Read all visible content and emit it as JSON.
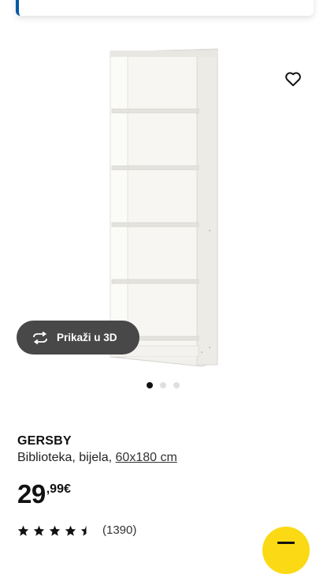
{
  "product": {
    "name": "GERSBY",
    "description_prefix": "Biblioteka, bijela, ",
    "size": "60x180 cm",
    "price_integer": "29",
    "price_decimal": ",99€",
    "rating_value": 4.5,
    "rating_max": 5,
    "review_count": "(1390)"
  },
  "viewer": {
    "button_3d_label": "Prikaži u 3D",
    "carousel_total": 3,
    "carousel_active": 1
  },
  "colors": {
    "accent_blue": "#0058a3",
    "fab_yellow": "#fbd914",
    "button_dark": "#484848"
  },
  "icons": {
    "favorite": "heart-outline-icon",
    "view_3d": "rotate-arrows-icon",
    "star": "star-icon",
    "fab": "menu-icon"
  }
}
